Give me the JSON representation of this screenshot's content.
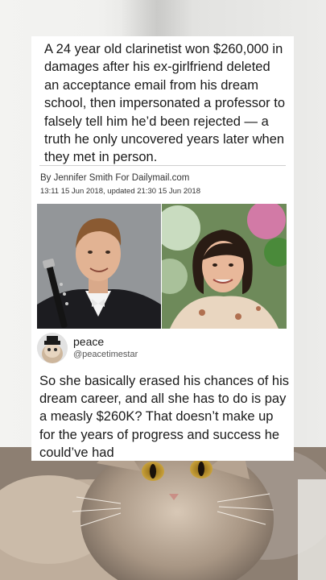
{
  "article": {
    "headline": "A 24 year old clarinetist won $260,000 in damages after his ex-girlfriend deleted an acceptance email from his dream school, then impersonated a professor to falsely tell him he’d been rejected — a truth he only uncovered years later when they met in person.",
    "byline": "By Jennifer Smith For Dailymail.com",
    "dateline": "13:11 15 Jun 2018, updated 21:30 15 Jun 2018"
  },
  "tweet": {
    "name": "peace",
    "handle": "@peacetimestar",
    "text": "So she basically erased his chances of his dream career, and all she has to do is pay a measly $260K? That doesn’t make up for the years of progress and success he could’ve had"
  }
}
